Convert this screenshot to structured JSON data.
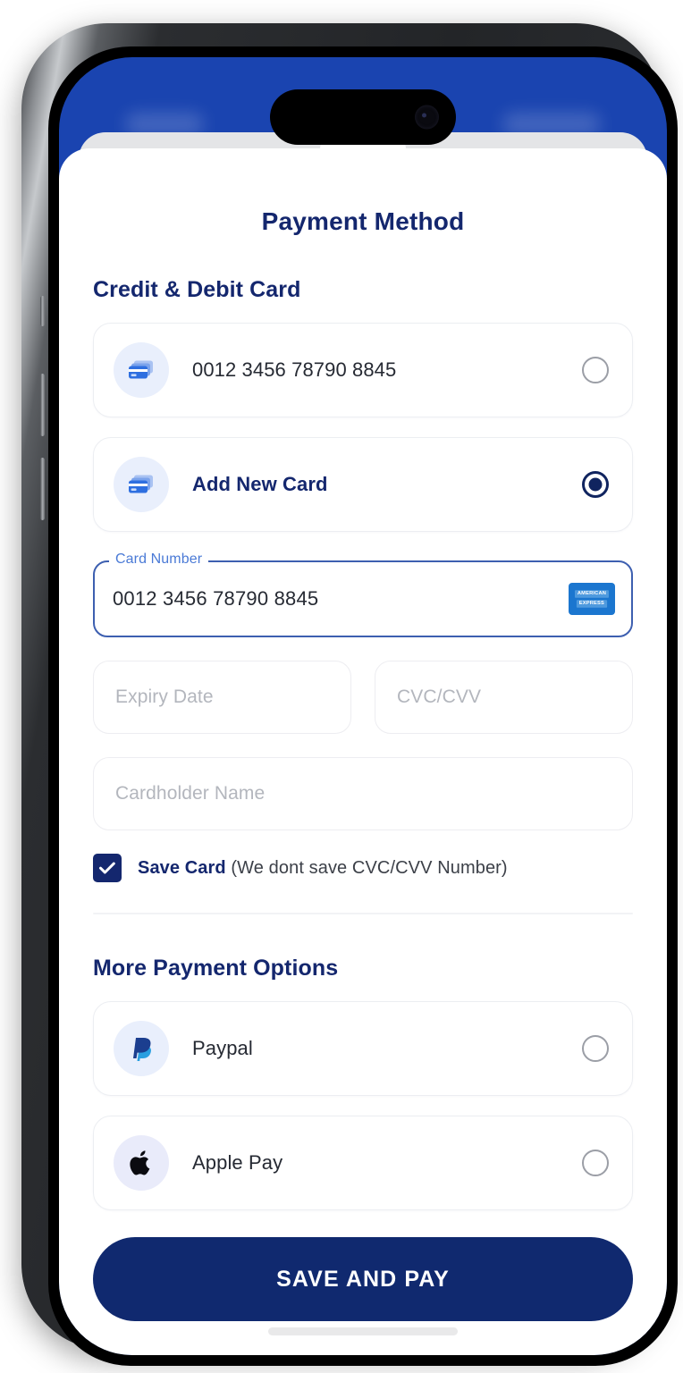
{
  "theme": {
    "brand_blue": "#1a44b0",
    "navy": "#14276e",
    "button_navy": "#10296f",
    "label_blue": "#4a7ad6",
    "amex_blue": "#1b76cf"
  },
  "screen": {
    "title": "Payment Method"
  },
  "credit_section": {
    "heading": "Credit & Debit Card",
    "options": [
      {
        "label": "0012 3456 78790 8845",
        "icon": "credit-card-icon",
        "selected": false
      },
      {
        "label": "Add New Card",
        "icon": "credit-card-icon",
        "selected": true
      }
    ]
  },
  "card_form": {
    "card_number": {
      "legend": "Card Number",
      "value": "0012 3456 78790 8845",
      "brand_icon": "amex-logo",
      "brand_line1": "AMERICAN",
      "brand_line2": "EXPRESS"
    },
    "expiry": {
      "placeholder": "Expiry Date",
      "value": ""
    },
    "cvc": {
      "placeholder": "CVC/CVV",
      "value": ""
    },
    "cardholder": {
      "placeholder": "Cardholder Name",
      "value": ""
    },
    "save_card": {
      "checked": true,
      "label_bold": "Save Card",
      "label_rest": " (We dont save CVC/CVV Number)",
      "check_glyph": "✓"
    }
  },
  "more_options": {
    "heading": "More Payment Options",
    "options": [
      {
        "label": "Paypal",
        "icon": "paypal-icon",
        "selected": false
      },
      {
        "label": "Apple Pay",
        "icon": "apple-icon",
        "selected": false
      }
    ]
  },
  "footer": {
    "primary_button": "SAVE AND PAY"
  }
}
